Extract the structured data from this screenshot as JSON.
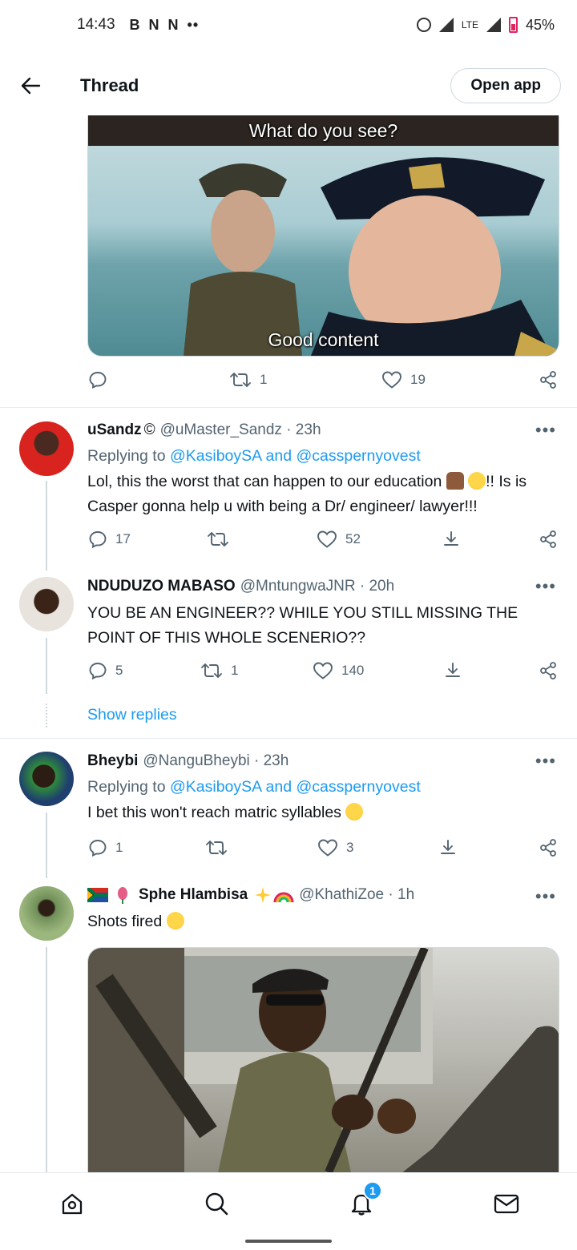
{
  "status_bar": {
    "time": "14:43",
    "notif_icons": [
      "B",
      "N",
      "N",
      "••"
    ],
    "network": "LTE",
    "battery": "45%"
  },
  "header": {
    "title": "Thread",
    "open_app": "Open app"
  },
  "main_image": {
    "caption_top": "What do you see?",
    "caption_bottom": "Good content"
  },
  "main_actions": {
    "retweets": "1",
    "likes": "19"
  },
  "replies": [
    {
      "name": "uSandz",
      "verified_mark": "©",
      "handle": "@uMaster_Sandz · 23h",
      "replying_prefix": "Replying to",
      "replying_to": "@KasiboySA and @casspernyovest",
      "text_1": "Lol, this the worst that can happen to our education",
      "text_2": "!! Is is Casper gonna help u with being a Dr/ engineer/ lawyer!!!",
      "replies": "17",
      "retweets": "",
      "likes": "52"
    },
    {
      "name": "NDUDUZO MABASO",
      "handle": "@MntungwaJNR · 20h",
      "text": "YOU BE AN ENGINEER?? WHILE YOU STILL MISSING THE POINT OF THIS WHOLE SCENERIO??",
      "replies": "5",
      "retweets": "1",
      "likes": "140",
      "show_replies": "Show replies"
    },
    {
      "name": "Bheybi",
      "handle": "@NanguBheybi · 23h",
      "replying_prefix": "Replying to",
      "replying_to": "@KasiboySA and @casspernyovest",
      "text": "I bet this won't reach matric syllables",
      "replies": "1",
      "retweets": "",
      "likes": "3"
    },
    {
      "name": "Sphe Hlambisa",
      "handle": "@KhathiZoe · 1h",
      "text": "Shots fired"
    }
  ],
  "bottom_nav": {
    "notification_count": "1"
  },
  "colors": {
    "accent": "#1d9bf0",
    "text": "#0f1419",
    "muted": "#536471",
    "border": "#cfd9de"
  }
}
